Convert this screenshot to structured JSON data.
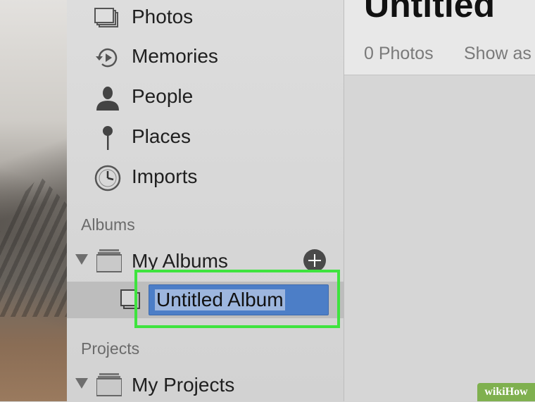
{
  "sidebar": {
    "nav_items": [
      {
        "label": "Photos",
        "icon": "photos-icon"
      },
      {
        "label": "Memories",
        "icon": "memories-icon"
      },
      {
        "label": "People",
        "icon": "people-icon"
      },
      {
        "label": "Places",
        "icon": "places-icon"
      },
      {
        "label": "Imports",
        "icon": "imports-icon"
      }
    ],
    "albums_header": "Albums",
    "my_albums_label": "My Albums",
    "rename_value": "Untitled Album",
    "projects_header": "Projects",
    "my_projects_label": "My Projects"
  },
  "main": {
    "album_title": "Untitled",
    "photo_count": "0 Photos",
    "show_as": "Show as"
  },
  "watermark": {
    "brand": "wikiHow"
  },
  "colors": {
    "highlight": "#3ee33e",
    "selection": "#4c7ec7",
    "watermark": "#7fb04f"
  }
}
